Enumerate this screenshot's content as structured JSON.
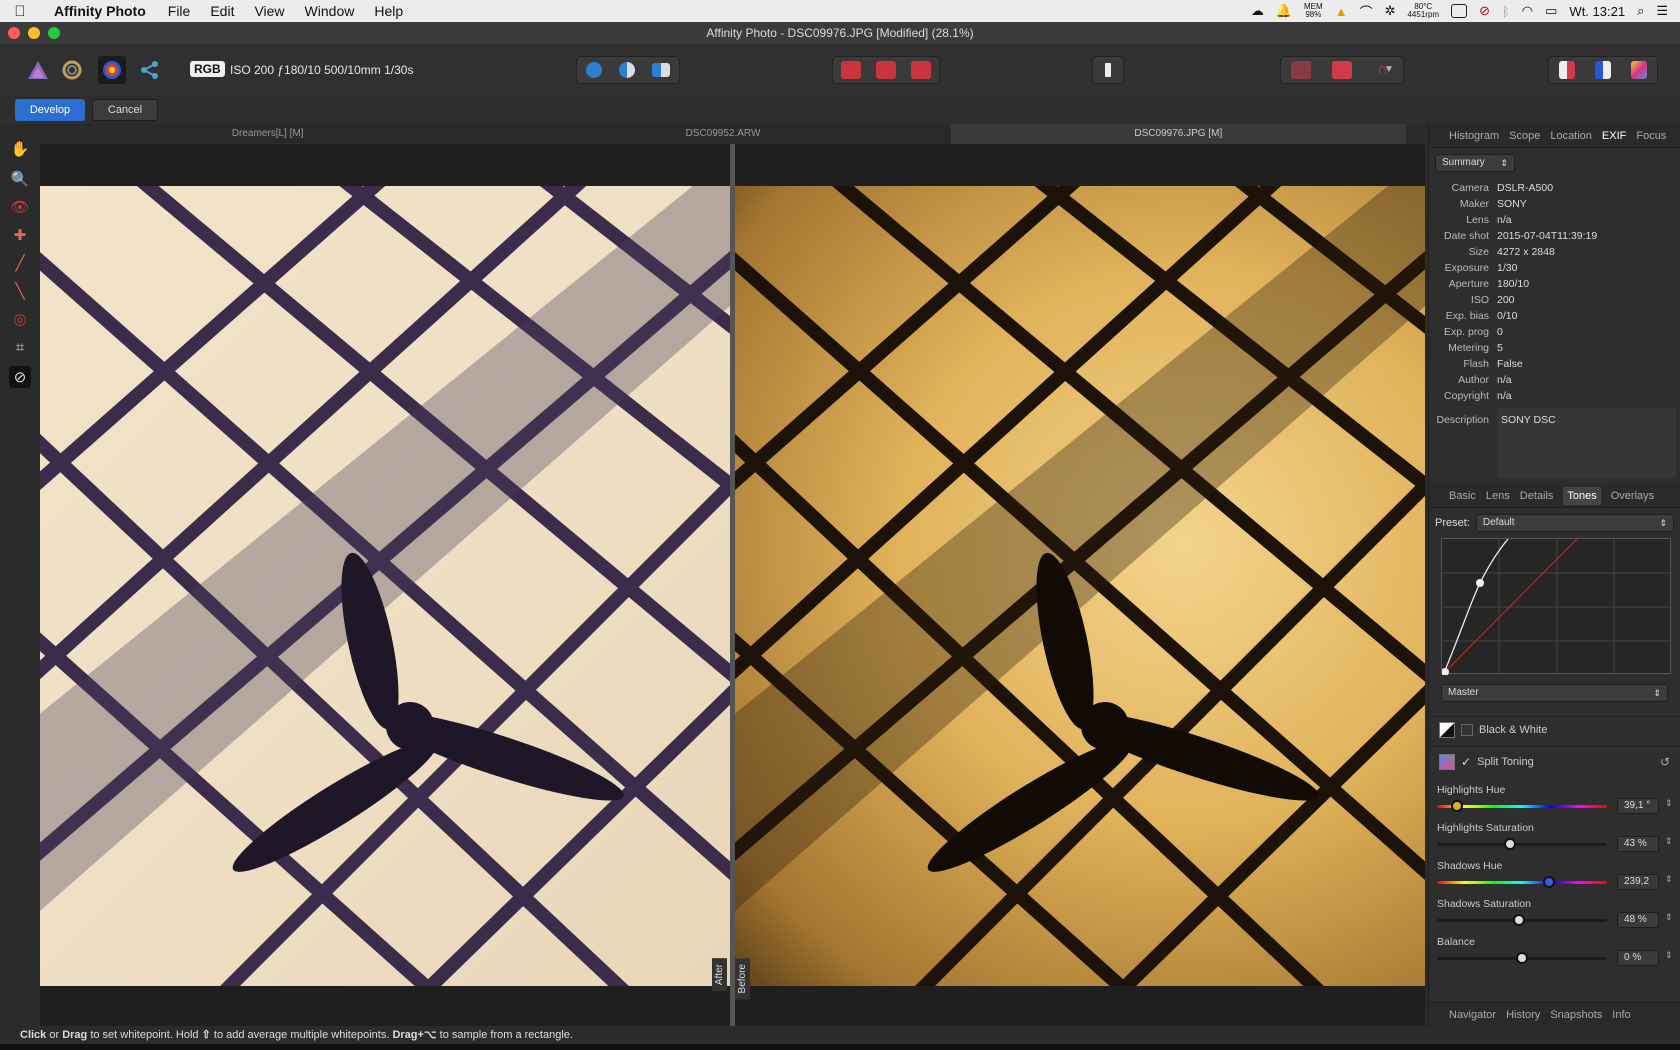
{
  "menubar": {
    "app_name": "Affinity Photo",
    "items": [
      "File",
      "Edit",
      "View",
      "Window",
      "Help"
    ],
    "mem_label": "MEM",
    "mem_value": "98%",
    "temp": "80°C",
    "rpm": "4451rpm",
    "clock": "Wt. 13:21"
  },
  "window": {
    "title": "Affinity Photo - DSC09976.JPG [Modified] (28.1%)"
  },
  "toolbar": {
    "rgb_badge": "RGB",
    "camera_info": "ISO 200 ƒ180/10 500/10mm 1/30s"
  },
  "contextbar": {
    "develop_label": "Develop",
    "cancel_label": "Cancel"
  },
  "document_tabs": [
    "Dreamers[L] [M]",
    "DSC09952.ARW",
    "DSC09976.JPG [M]"
  ],
  "split_view": {
    "after_label": "After",
    "before_label": "Before"
  },
  "exif_panel": {
    "tabs": [
      "Histogram",
      "Scope",
      "Location",
      "EXIF",
      "Focus"
    ],
    "active_tab": "EXIF",
    "mode_select": "Summary",
    "rows": [
      {
        "key": "Camera",
        "value": "DSLR-A500"
      },
      {
        "key": "Maker",
        "value": "SONY"
      },
      {
        "key": "Lens",
        "value": "n/a"
      },
      {
        "key": "Date shot",
        "value": "2015-07-04T11:39:19"
      },
      {
        "key": "Size",
        "value": "4272 x 2848"
      },
      {
        "key": "Exposure",
        "value": "1/30"
      },
      {
        "key": "Aperture",
        "value": "180/10"
      },
      {
        "key": "ISO",
        "value": "200"
      },
      {
        "key": "Exp. bias",
        "value": "0/10"
      },
      {
        "key": "Exp. prog",
        "value": "0"
      },
      {
        "key": "Metering",
        "value": "5"
      },
      {
        "key": "Flash",
        "value": "False"
      },
      {
        "key": "Author",
        "value": "n/a"
      },
      {
        "key": "Copyright",
        "value": "n/a"
      }
    ],
    "description_label": "Description",
    "description_value": "SONY DSC"
  },
  "develop_panel": {
    "tabs": [
      "Basic",
      "Lens",
      "Details",
      "Tones",
      "Overlays"
    ],
    "active_tab": "Tones",
    "preset_label": "Preset:",
    "preset_value": "Default",
    "curve_channel": "Master",
    "black_white_label": "Black & White",
    "black_white_checked": false,
    "split_toning_label": "Split Toning",
    "split_toning_checked": true,
    "sliders": [
      {
        "label": "Highlights Hue",
        "value": "39,1 °",
        "position": 0.12,
        "type": "hue"
      },
      {
        "label": "Highlights Saturation",
        "value": "43 %",
        "position": 0.43,
        "type": "plain"
      },
      {
        "label": "Shadows Hue",
        "value": "239,2",
        "position": 0.66,
        "type": "hue"
      },
      {
        "label": "Shadows Saturation",
        "value": "48 %",
        "position": 0.48,
        "type": "plain"
      },
      {
        "label": "Balance",
        "value": "0 %",
        "position": 0.5,
        "type": "plain"
      }
    ]
  },
  "bottom_tabs": [
    "Navigator",
    "History",
    "Snapshots",
    "Info"
  ],
  "status": {
    "click": "Click",
    "or": " or ",
    "drag": "Drag",
    "text1": " to set whitepoint. Hold ",
    "shift": "⇧",
    "text2": " to add average multiple whitepoints. ",
    "drag_alt": "Drag+⌥",
    "text3": " to sample from a rectangle."
  }
}
